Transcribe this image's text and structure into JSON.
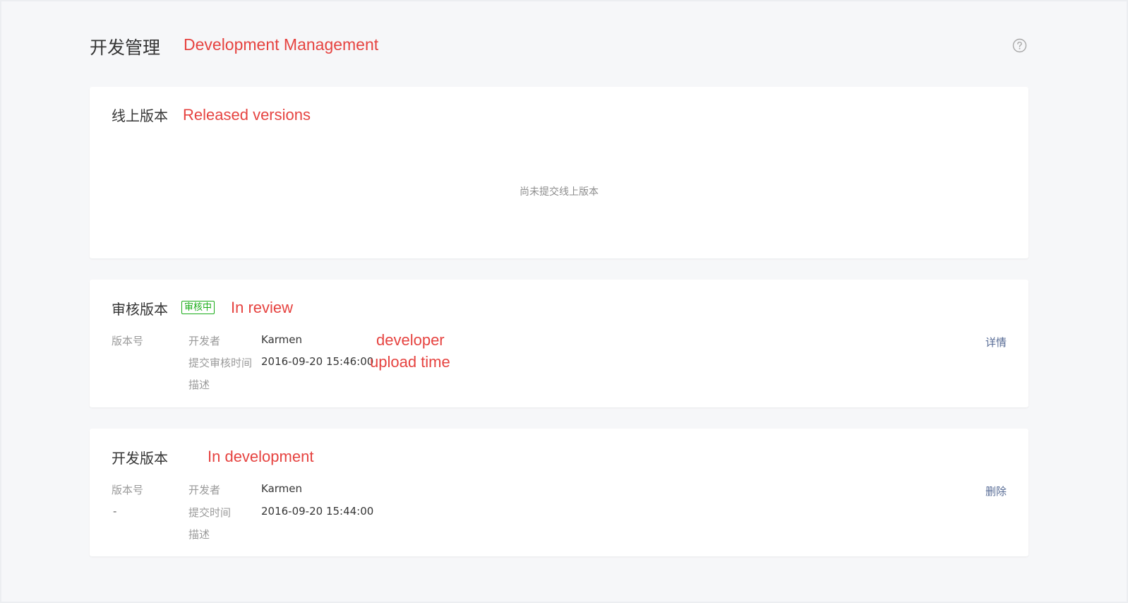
{
  "page": {
    "title": "开发管理",
    "title_annotation": "Development Management",
    "help_icon": "question-circle-icon"
  },
  "online": {
    "title": "线上版本",
    "annotation": "Released versions",
    "empty_text": "尚未提交线上版本"
  },
  "review": {
    "title": "审核版本",
    "status_tag": "审核中",
    "annotation": "In review",
    "version_label": "版本号",
    "developer_label": "开发者",
    "developer": "Karmen",
    "developer_annotation": "developer",
    "submit_time_label": "提交审核时间",
    "submit_time": "2016-09-20 15:46:00",
    "submit_time_annotation": "upload time",
    "description_label": "描述",
    "action_label": "详情"
  },
  "dev": {
    "title": "开发版本",
    "annotation": "In development",
    "version_label": "版本号",
    "version_value": "-",
    "developer_label": "开发者",
    "developer": "Karmen",
    "submit_time_label": "提交时间",
    "submit_time": "2016-09-20 15:44:00",
    "description_label": "描述",
    "action_label": "删除"
  },
  "colors": {
    "annotation": "#e64340",
    "link": "#576b95",
    "tag": "#1aad19"
  }
}
